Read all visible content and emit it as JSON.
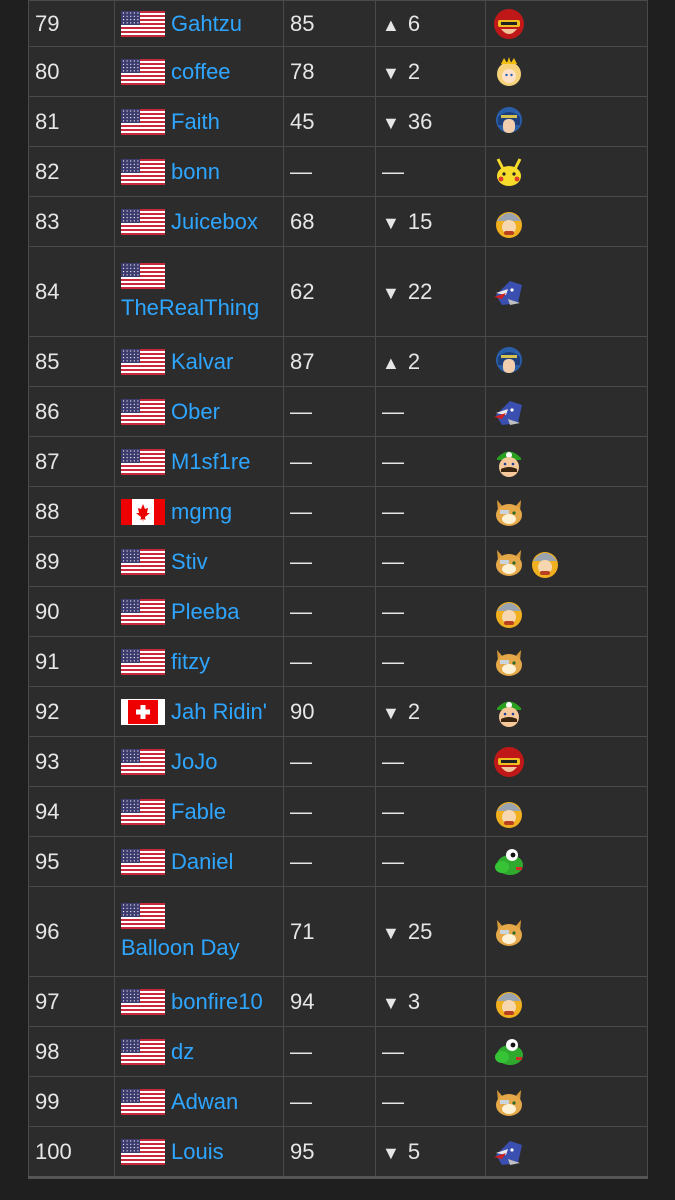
{
  "colors": {
    "page_bg": "#1f1f1f",
    "table_bg": "#2c2c2c",
    "border": "#4a4a4a",
    "text": "#e6e6e6",
    "link": "#2ea6ff"
  },
  "rows": [
    {
      "rank": "79",
      "flag": "us-flag",
      "player": "Gahtzu",
      "score": "85",
      "change_arrow": "▲",
      "change_value": "6",
      "characters": [
        "captain-falcon-icon"
      ]
    },
    {
      "rank": "80",
      "flag": "us-flag",
      "player": "coffee",
      "score": "78",
      "change_arrow": "▼",
      "change_value": "2",
      "characters": [
        "peach-icon"
      ]
    },
    {
      "rank": "81",
      "flag": "us-flag",
      "player": "Faith",
      "score": "45",
      "change_arrow": "▼",
      "change_value": "36",
      "characters": [
        "marth-icon"
      ]
    },
    {
      "rank": "82",
      "flag": "us-flag",
      "player": "bonn",
      "score": "—",
      "change_arrow": "",
      "change_value": "—",
      "characters": [
        "pikachu-icon"
      ]
    },
    {
      "rank": "83",
      "flag": "us-flag",
      "player": "Juicebox",
      "score": "68",
      "change_arrow": "▼",
      "change_value": "15",
      "characters": [
        "ice-climbers-icon"
      ]
    },
    {
      "rank": "84",
      "flag": "us-flag",
      "player": "TheRealThing",
      "score": "62",
      "change_arrow": "▼",
      "change_value": "22",
      "characters": [
        "falco-icon"
      ],
      "tall": true
    },
    {
      "rank": "85",
      "flag": "us-flag",
      "player": "Kalvar",
      "score": "87",
      "change_arrow": "▲",
      "change_value": "2",
      "characters": [
        "marth-icon"
      ]
    },
    {
      "rank": "86",
      "flag": "us-flag",
      "player": "Ober",
      "score": "—",
      "change_arrow": "",
      "change_value": "—",
      "characters": [
        "falco-icon"
      ]
    },
    {
      "rank": "87",
      "flag": "us-flag",
      "player": "M1sf1re",
      "score": "—",
      "change_arrow": "",
      "change_value": "—",
      "characters": [
        "luigi-icon"
      ]
    },
    {
      "rank": "88",
      "flag": "canada-flag",
      "player": "mgmg",
      "score": "—",
      "change_arrow": "",
      "change_value": "—",
      "characters": [
        "fox-icon"
      ]
    },
    {
      "rank": "89",
      "flag": "us-flag",
      "player": "Stiv",
      "score": "—",
      "change_arrow": "",
      "change_value": "—",
      "characters": [
        "fox-icon",
        "ice-climbers-icon"
      ]
    },
    {
      "rank": "90",
      "flag": "us-flag",
      "player": "Pleeba",
      "score": "—",
      "change_arrow": "",
      "change_value": "—",
      "characters": [
        "ice-climbers-icon"
      ]
    },
    {
      "rank": "91",
      "flag": "us-flag",
      "player": "fitzy",
      "score": "—",
      "change_arrow": "",
      "change_value": "—",
      "characters": [
        "fox-icon"
      ]
    },
    {
      "rank": "92",
      "flag": "swiss-flag",
      "player": "Jah Ridin'",
      "score": "90",
      "change_arrow": "▼",
      "change_value": "2",
      "characters": [
        "luigi-icon"
      ]
    },
    {
      "rank": "93",
      "flag": "us-flag",
      "player": "JoJo",
      "score": "—",
      "change_arrow": "",
      "change_value": "—",
      "characters": [
        "captain-falcon-icon"
      ]
    },
    {
      "rank": "94",
      "flag": "us-flag",
      "player": "Fable",
      "score": "—",
      "change_arrow": "",
      "change_value": "—",
      "characters": [
        "ice-climbers-icon"
      ]
    },
    {
      "rank": "95",
      "flag": "us-flag",
      "player": "Daniel",
      "score": "—",
      "change_arrow": "",
      "change_value": "—",
      "characters": [
        "yoshi-icon"
      ]
    },
    {
      "rank": "96",
      "flag": "us-flag",
      "player": "Balloon Day",
      "score": "71",
      "change_arrow": "▼",
      "change_value": "25",
      "characters": [
        "fox-icon"
      ],
      "tall": true
    },
    {
      "rank": "97",
      "flag": "us-flag",
      "player": "bonfire10",
      "score": "94",
      "change_arrow": "▼",
      "change_value": "3",
      "characters": [
        "ice-climbers-icon"
      ]
    },
    {
      "rank": "98",
      "flag": "us-flag",
      "player": "dz",
      "score": "—",
      "change_arrow": "",
      "change_value": "—",
      "characters": [
        "yoshi-icon"
      ]
    },
    {
      "rank": "99",
      "flag": "us-flag",
      "player": "Adwan",
      "score": "—",
      "change_arrow": "",
      "change_value": "—",
      "characters": [
        "fox-icon"
      ]
    },
    {
      "rank": "100",
      "flag": "us-flag",
      "player": "Louis",
      "score": "95",
      "change_arrow": "▼",
      "change_value": "5",
      "characters": [
        "falco-icon"
      ]
    }
  ]
}
